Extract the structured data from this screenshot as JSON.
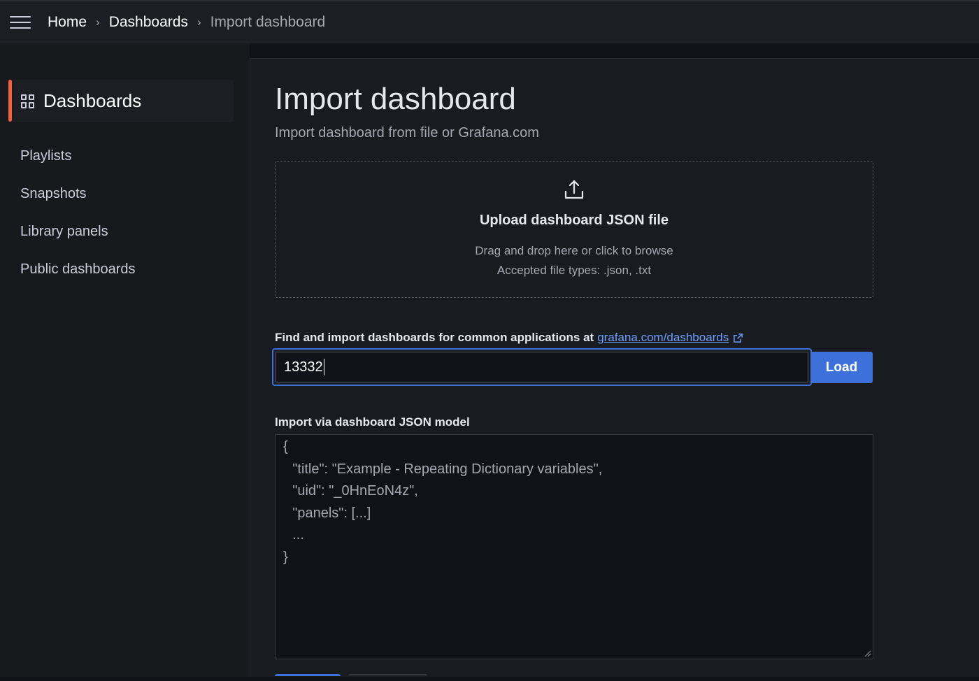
{
  "breadcrumb": {
    "items": [
      "Home",
      "Dashboards",
      "Import dashboard"
    ],
    "separator": "›"
  },
  "sidebar": {
    "active": {
      "label": "Dashboards",
      "icon": "apps-grid-icon"
    },
    "items": [
      {
        "label": "Playlists"
      },
      {
        "label": "Snapshots"
      },
      {
        "label": "Library panels"
      },
      {
        "label": "Public dashboards"
      }
    ]
  },
  "page": {
    "title": "Import dashboard",
    "subtitle": "Import dashboard from file or Grafana.com"
  },
  "upload": {
    "icon": "upload-icon",
    "title": "Upload dashboard JSON file",
    "hint": "Drag and drop here or click to browse",
    "accepted": "Accepted file types: .json, .txt"
  },
  "find": {
    "label": "Find and import dashboards for common applications at",
    "link_text": "grafana.com/dashboards",
    "input_value": "13332",
    "load_label": "Load"
  },
  "json_model": {
    "label": "Import via dashboard JSON model",
    "placeholder_lines": [
      "{",
      "    \"title\": \"Example - Repeating Dictionary variables\",",
      "    \"uid\": \"_0HnEoN4z\",",
      "    \"panels\": [...]",
      "    ...",
      "}"
    ]
  },
  "colors": {
    "accent": "#3d71d9",
    "active_indicator": "#f55f3e",
    "link": "#6e9fff"
  }
}
